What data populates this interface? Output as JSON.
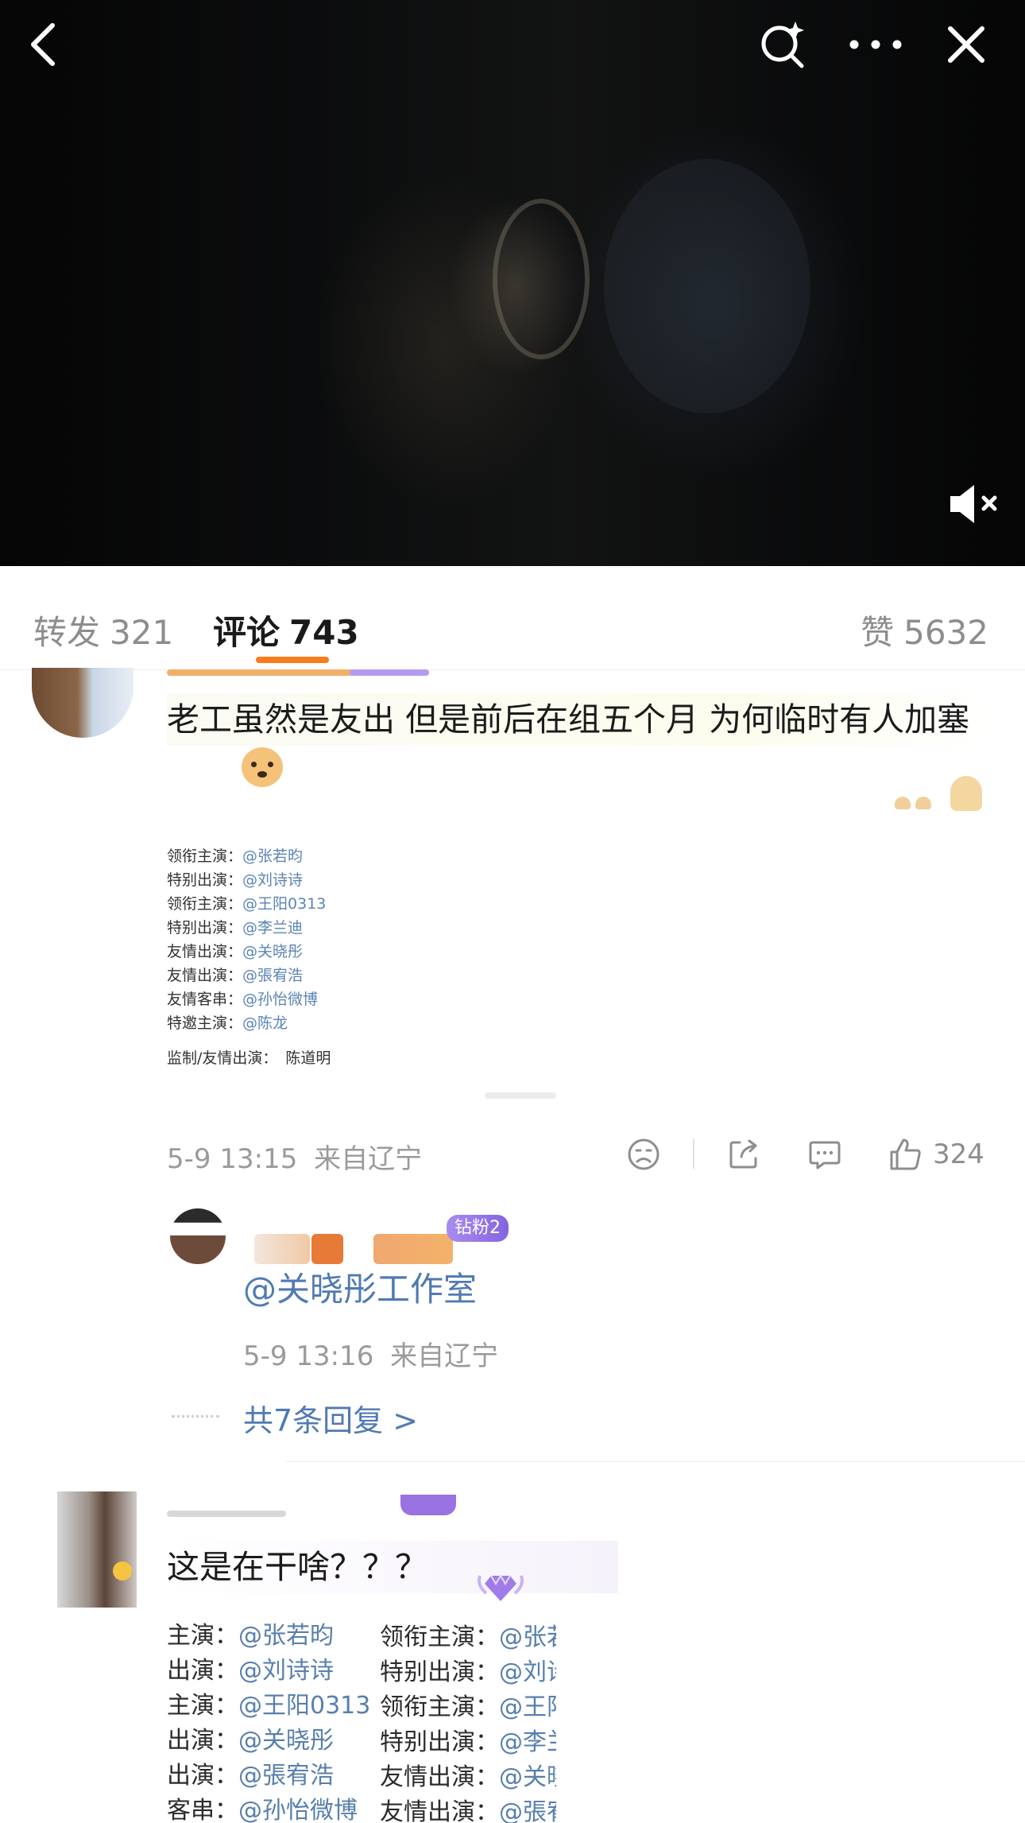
{
  "video": {
    "back_icon": "chevron-left-icon",
    "search_icon": "search-sparkle-icon",
    "more_icon": "ellipsis-icon",
    "close_icon": "close-icon",
    "mute_icon": "speaker-muted-icon"
  },
  "tabs": {
    "repost_label": "转发",
    "repost_count": "321",
    "comment_label": "评论",
    "comment_count": "743",
    "like_label": "赞",
    "like_count": "5632",
    "accent_color": "#f77b1b"
  },
  "comment1": {
    "text": "老工虽然是友出 但是前后在组五个月 为何临时有人加塞",
    "credits": [
      {
        "role": "领衔主演：",
        "name": "@张若昀"
      },
      {
        "role": "特别出演：",
        "name": "@刘诗诗"
      },
      {
        "role": "领衔主演：",
        "name": "@王阳0313"
      },
      {
        "role": "特别出演：",
        "name": "@李兰迪"
      },
      {
        "role": "友情出演：",
        "name": "@关晓彤"
      },
      {
        "role": "友情出演：",
        "name": "@張宥浩"
      },
      {
        "role": "友情客串：",
        "name": "@孙怡微博"
      },
      {
        "role": "特邀主演：",
        "name": "@陈龙"
      }
    ],
    "producer_role": "监制/友情出演：",
    "producer_name": "陈道明",
    "time": "5-9 13:15",
    "location": "来自辽宁",
    "like_count": "324"
  },
  "reply1": {
    "fan_badge": "钻粉2",
    "mention": "@关晓彤工作室",
    "time": "5-9 13:16",
    "location": "来自辽宁",
    "reply_count_text": "共7条回复 >"
  },
  "comment2": {
    "text": "这是在干啥？？？",
    "credits_left": [
      {
        "role": "主演：",
        "name": "@张若昀"
      },
      {
        "role": "出演：",
        "name": "@刘诗诗"
      },
      {
        "role": "主演：",
        "name": "@王阳0313"
      },
      {
        "role": "出演：",
        "name": "@关晓彤"
      },
      {
        "role": "出演：",
        "name": "@張宥浩"
      },
      {
        "role": "客串：",
        "name": "@孙怡微博"
      }
    ],
    "credits_right": [
      {
        "role": "领衔主演：",
        "name": "@张若"
      },
      {
        "role": "特别出演：",
        "name": "@刘诗"
      },
      {
        "role": "领衔主演：",
        "name": "@王阳"
      },
      {
        "role": "特别出演：",
        "name": "@李兰"
      },
      {
        "role": "友情出演：",
        "name": "@关晓"
      },
      {
        "role": "友情出演：",
        "name": "@張宥"
      }
    ]
  }
}
